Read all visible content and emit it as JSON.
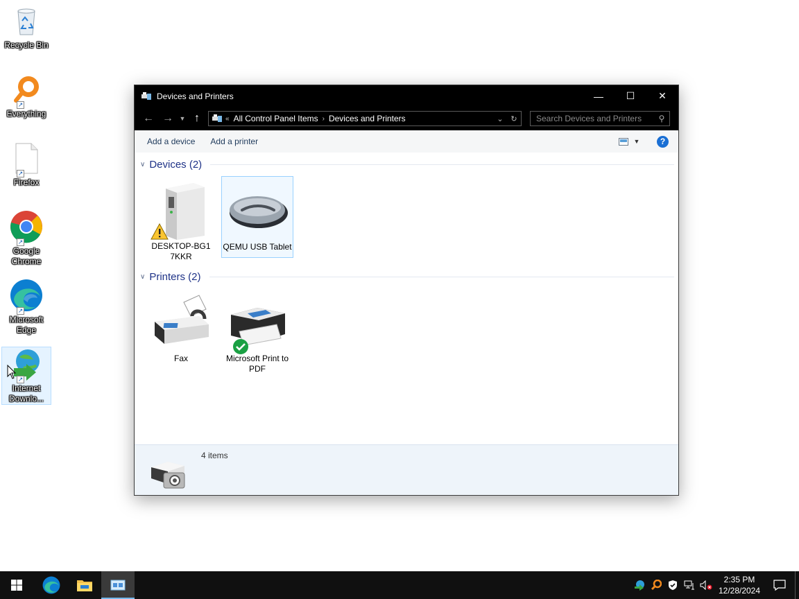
{
  "desktop": {
    "icons": [
      {
        "label": "Recycle Bin",
        "icon": "recycle-bin-icon"
      },
      {
        "label": "Everything",
        "icon": "everything-search-icon"
      },
      {
        "label": "Firefox",
        "icon": "blank-file-icon"
      },
      {
        "label": "Google Chrome",
        "icon": "chrome-icon"
      },
      {
        "label": "Microsoft Edge",
        "icon": "edge-icon"
      },
      {
        "label": "Internet Downlo...",
        "icon": "internet-download-manager-icon"
      }
    ]
  },
  "window": {
    "title": "Devices and Printers",
    "controls": {
      "minimize": "—",
      "maximize": "☐",
      "close": "✕"
    },
    "address": {
      "overflow": "«",
      "crumbs": [
        "All Control Panel Items",
        "Devices and Printers"
      ],
      "separator": "›"
    },
    "search": {
      "placeholder": "Search Devices and Printers"
    },
    "commands": {
      "add_device": "Add a device",
      "add_printer": "Add a printer",
      "help": "?"
    },
    "groups": {
      "devices": {
        "label": "Devices (2)",
        "items": [
          {
            "label": "DESKTOP-BG17KKR",
            "icon": "computer-tower-icon",
            "badge": "warning-icon"
          },
          {
            "label": "QEMU USB Tablet",
            "icon": "mouse-icon",
            "selected": true
          }
        ]
      },
      "printers": {
        "label": "Printers (2)",
        "items": [
          {
            "label": "Fax",
            "icon": "fax-icon"
          },
          {
            "label": "Microsoft Print to PDF",
            "icon": "printer-icon",
            "badge": "default-check-icon"
          }
        ]
      }
    },
    "details": {
      "count": "4 items"
    }
  },
  "taskbar": {
    "clock": {
      "time": "2:35 PM",
      "date": "12/28/2024"
    },
    "colors": {
      "background": "#101010",
      "active_indicator": "#76b9ed"
    }
  }
}
